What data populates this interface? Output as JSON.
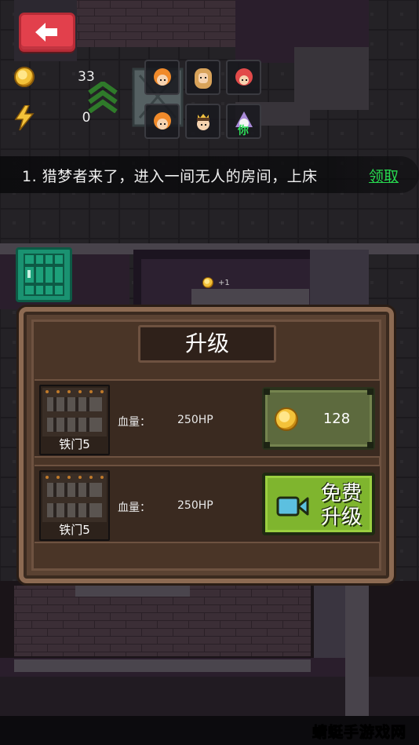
{
  "hud": {
    "back_icon": "back-arrow-icon",
    "coins": "33",
    "energy": "0",
    "rank_icon": "rank-chevron-icon"
  },
  "heroes": [
    {
      "name": "orange-hair-hero",
      "color": "#f08a2a"
    },
    {
      "name": "blonde-girl-hero",
      "color": "#d9a35a"
    },
    {
      "name": "red-hair-hero",
      "color": "#e24a4a"
    },
    {
      "name": "orange-hair-hero-2",
      "color": "#f08a2a"
    },
    {
      "name": "prince-hero",
      "color": "#f0c040"
    },
    {
      "name": "purple-hair-hero-you",
      "color": "#a98ad8",
      "tag": "你"
    }
  ],
  "task": {
    "text": "1. 猎梦者来了，进入一间无人的房间，上床",
    "claim": "领取"
  },
  "map": {
    "coin_plus": "+1"
  },
  "dialog": {
    "title": "升级",
    "rows": [
      {
        "item": "铁门5",
        "hp_label": "血量：",
        "hp_value": "250HP",
        "button_type": "coin",
        "price": "128"
      },
      {
        "item": "铁门5",
        "hp_label": "血量：",
        "hp_value": "250HP",
        "button_type": "video",
        "button_text": "免费升级"
      }
    ]
  },
  "watermark": "蜻蜓手游戏网",
  "colors": {
    "back_button": "#e2404c",
    "claim_link": "#27d84f",
    "free_button": "#7fb52e",
    "cost_button": "#5d6a3e",
    "dialog_frame": "#8c6a52"
  }
}
